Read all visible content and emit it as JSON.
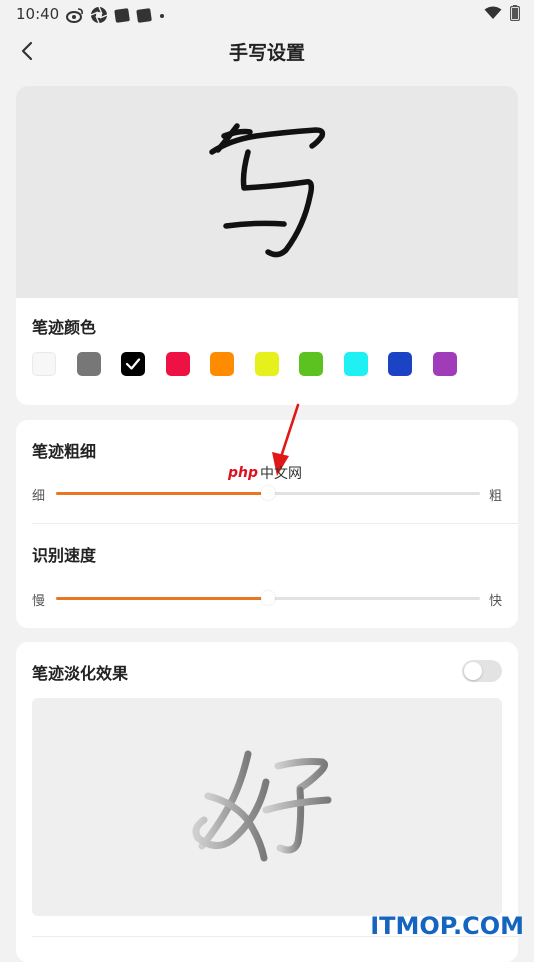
{
  "status_bar": {
    "time": "10:40"
  },
  "header": {
    "title": "手写设置"
  },
  "stroke_color": {
    "title": "笔迹颜色",
    "selected_index": 2,
    "swatches": [
      {
        "color": "#f7f7f7"
      },
      {
        "color": "#777777"
      },
      {
        "color": "#000000"
      },
      {
        "color": "#ee1144"
      },
      {
        "color": "#ff8c00"
      },
      {
        "color": "#e5f01d"
      },
      {
        "color": "#5bc21f"
      },
      {
        "color": "#1ef0f3"
      },
      {
        "color": "#1a44c4"
      },
      {
        "color": "#a03cba"
      }
    ]
  },
  "stroke_width": {
    "title": "笔迹粗细",
    "min_label": "细",
    "max_label": "粗",
    "value": 0.5
  },
  "recognition_speed": {
    "title": "识别速度",
    "min_label": "慢",
    "max_label": "快",
    "value": 0.5
  },
  "fade_effect": {
    "title": "笔迹淡化效果",
    "enabled": false
  },
  "watermarks": {
    "php_brand": "php",
    "php_site": "中文网",
    "itmop": "ITMOP.COM"
  },
  "colors": {
    "accent": "#e87722",
    "background": "#f2f2f2",
    "card": "#ffffff"
  }
}
